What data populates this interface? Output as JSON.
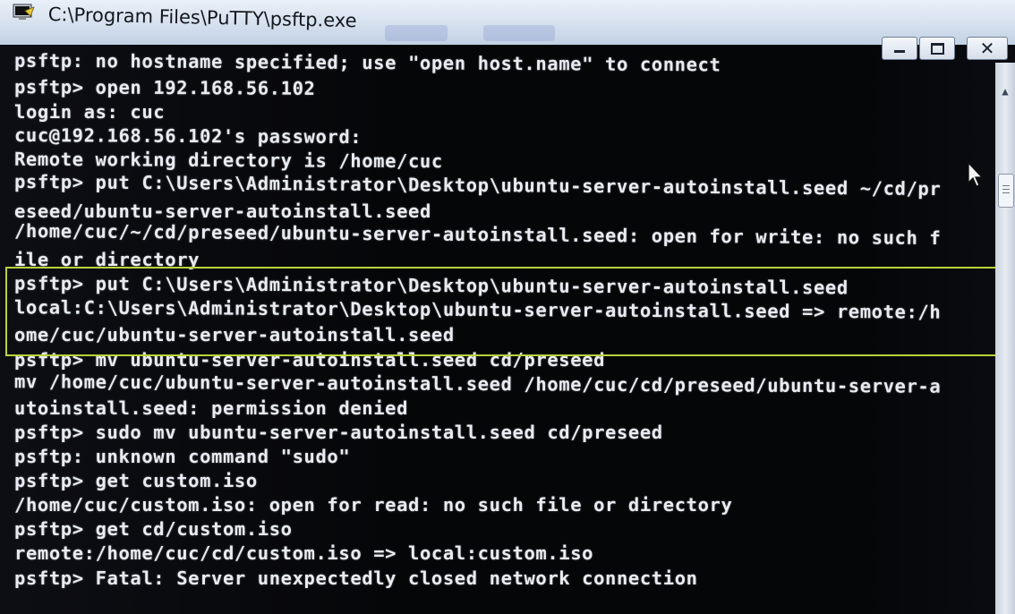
{
  "window": {
    "title": "C:\\Program Files\\PuTTY\\psftp.exe",
    "icon": "putty-terminal-icon"
  },
  "controls": {
    "minimize": "minimize",
    "maximize": "maximize",
    "close": "✕"
  },
  "terminal": {
    "lines": [
      "psftp: no hostname specified; use \"open host.name\" to connect",
      "psftp> open 192.168.56.102",
      "login as: cuc",
      "cuc@192.168.56.102's password:",
      "Remote working directory is /home/cuc",
      "psftp> put C:\\Users\\Administrator\\Desktop\\ubuntu-server-autoinstall.seed ~/cd/pr",
      "eseed/ubuntu-server-autoinstall.seed",
      "/home/cuc/~/cd/preseed/ubuntu-server-autoinstall.seed: open for write: no such f",
      "ile or directory",
      "psftp> put C:\\Users\\Administrator\\Desktop\\ubuntu-server-autoinstall.seed",
      "local:C:\\Users\\Administrator\\Desktop\\ubuntu-server-autoinstall.seed => remote:/h",
      "ome/cuc/ubuntu-server-autoinstall.seed",
      "psftp> mv ubuntu-server-autoinstall.seed cd/preseed",
      "mv /home/cuc/ubuntu-server-autoinstall.seed /home/cuc/cd/preseed/ubuntu-server-a",
      "utoinstall.seed: permission denied",
      "psftp> sudo mv ubuntu-server-autoinstall.seed cd/preseed",
      "psftp: unknown command \"sudo\"",
      "psftp> get custom.iso",
      "/home/cuc/custom.iso: open for read: no such file or directory",
      "psftp> get cd/custom.iso",
      "remote:/home/cuc/cd/custom.iso => local:custom.iso",
      "psftp> Fatal: Server unexpectedly closed network connection"
    ]
  },
  "colors": {
    "terminal_bg": "#050608",
    "terminal_fg": "#e8ecf2",
    "highlight_border": "#b8d43a"
  }
}
